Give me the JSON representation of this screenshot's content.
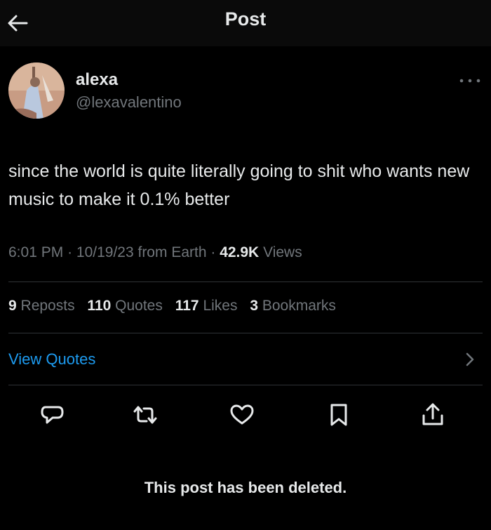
{
  "header": {
    "title": "Post",
    "back_icon": "back-arrow-icon"
  },
  "author": {
    "name": "alexa",
    "handle": "@lexavalentino"
  },
  "post": {
    "text": "since the world is quite literally going to shit who wants new music to make it 0.1% better",
    "time": "6:01 PM",
    "date": "10/19/23",
    "source": "from Earth",
    "views_count": "42.9K",
    "views_label": "Views"
  },
  "stats": {
    "reposts": {
      "count": "9",
      "label": "Reposts"
    },
    "quotes": {
      "count": "110",
      "label": "Quotes"
    },
    "likes": {
      "count": "117",
      "label": "Likes"
    },
    "bookmarks": {
      "count": "3",
      "label": "Bookmarks"
    }
  },
  "view_quotes": {
    "label": "View Quotes"
  },
  "notice": "This post has been deleted.",
  "colors": {
    "background": "#000000",
    "text": "#e7e9ea",
    "muted": "#71767b",
    "link": "#1d9bf0"
  },
  "icons": [
    "reply-icon",
    "repost-icon",
    "like-icon",
    "bookmark-icon",
    "share-icon"
  ]
}
